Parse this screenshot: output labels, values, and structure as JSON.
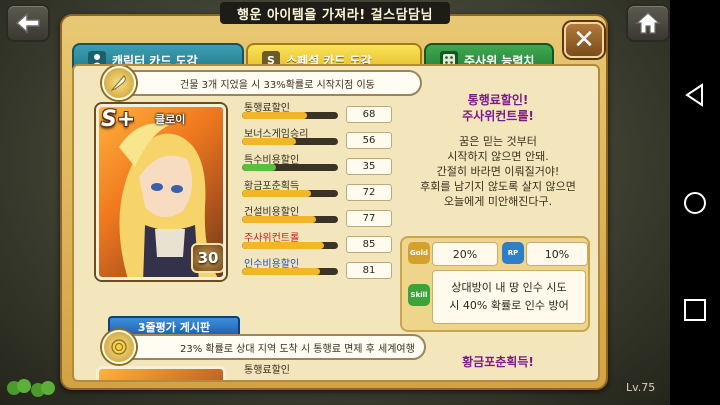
{
  "header": {
    "title": "행운 아이템을 가져라! 걸스담담님",
    "back_icon": "back-arrow-icon",
    "home_icon": "home-icon"
  },
  "tabs": [
    {
      "label": "캐릭터 카드 도감",
      "icon": "person-icon",
      "active": false
    },
    {
      "label": "스페셜 카드 도감",
      "icon_text": "S",
      "active": true
    },
    {
      "label": "주사위 능력치",
      "icon": "dice-icon",
      "active": false
    }
  ],
  "card1": {
    "ability": "건물 3개 지었을 시 33%확률로 시작지점 이동",
    "rank": "S+",
    "name": "클로이",
    "level": "30",
    "review_button": "3줄평가 게시판",
    "stats": [
      {
        "label": "통행료할인",
        "value": "68",
        "fill": 0.68,
        "color": "#f3b628",
        "style": "normal"
      },
      {
        "label": "보너스게임승리",
        "value": "56",
        "fill": 0.56,
        "color": "#f3b628",
        "style": "normal"
      },
      {
        "label": "특수비용할인",
        "value": "35",
        "fill": 0.35,
        "color": "#5bbf3a",
        "style": "normal"
      },
      {
        "label": "황금포춘획득",
        "value": "72",
        "fill": 0.72,
        "color": "#f3b628",
        "style": "normal"
      },
      {
        "label": "건설비용할인",
        "value": "77",
        "fill": 0.77,
        "color": "#f3b628",
        "style": "normal"
      },
      {
        "label": "주사위컨트롤",
        "value": "85",
        "fill": 0.85,
        "color": "#f3b628",
        "style": "red"
      },
      {
        "label": "인수비용할인",
        "value": "81",
        "fill": 0.81,
        "color": "#f3b628",
        "style": "blue"
      }
    ],
    "desc_title": [
      "통행료할인!",
      "주사위컨트롤!"
    ],
    "desc_lines": [
      "꿈은 믿는 것부터",
      "시작하지 않으면 안돼.",
      "간절히 바라면 이뤄질거야!",
      "후회를 남기지 않도록 살지 않으면",
      "오늘에게 미안해진다구."
    ],
    "effects": {
      "gold_label": "Gold",
      "gold_value": "20%",
      "rp_label": "RP",
      "rp_value": "10%",
      "skill_label": "Skill",
      "skill_text": [
        "상대방이 내 땅 인수 시도",
        "시 40% 확률로 인수 방어"
      ]
    }
  },
  "card2": {
    "ability": "23% 확률로 상대 지역 도착 시 통행료 면제 후 세계여행",
    "first_stat": "통행료할인",
    "desc_title": "황금포춘획득!"
  },
  "footer": {
    "level": "Lv.75"
  }
}
